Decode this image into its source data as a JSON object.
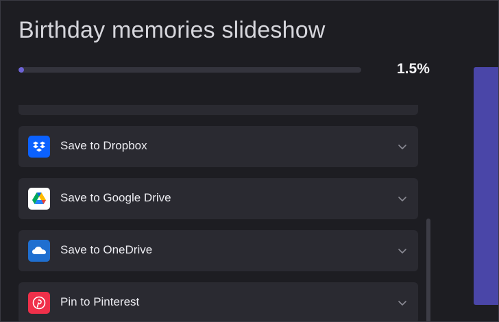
{
  "header": {
    "title": "Birthday memories slideshow"
  },
  "progress": {
    "label": "1.5%",
    "value_percent": 1.5
  },
  "colors": {
    "accent": "#6d63d6",
    "side_panel": "#4a46a8",
    "background": "#1d1d22",
    "card": "#2a2a31"
  },
  "export_options": {
    "items": [
      {
        "label": "Save to Dropbox",
        "icon": "dropbox-icon",
        "icon_bg": "#0b61ff"
      },
      {
        "label": "Save to Google Drive",
        "icon": "google-drive-icon",
        "icon_bg": "#ffffff"
      },
      {
        "label": "Save to OneDrive",
        "icon": "onedrive-icon",
        "icon_bg": "#1f6fd0"
      },
      {
        "label": "Pin to Pinterest",
        "icon": "pinterest-icon",
        "icon_bg": "#f0304a"
      }
    ]
  }
}
